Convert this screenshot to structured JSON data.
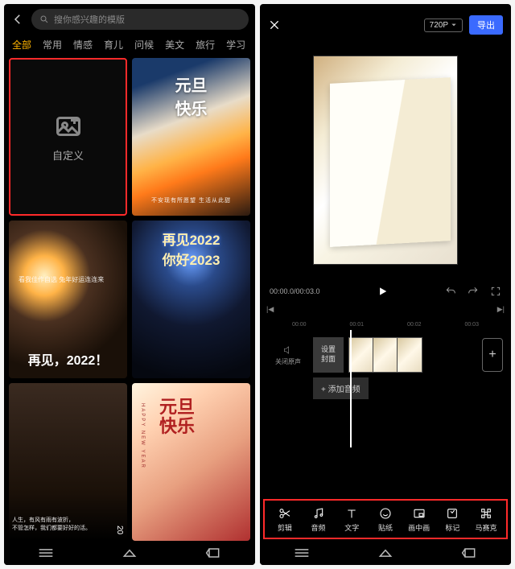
{
  "left": {
    "search_placeholder": "搜你感兴趣的模版",
    "tabs": [
      "全部",
      "常用",
      "情感",
      "育儿",
      "问候",
      "美文",
      "旅行",
      "学习"
    ],
    "custom_label": "自定义",
    "card_sunset": {
      "title": "元旦\n快乐",
      "sub": "不安现有所愿望  生活从此甜"
    },
    "card_fw1": {
      "small": "看我佳作自选  兔年好运连连来",
      "bottom": "再见，2022！"
    },
    "card_fw2": {
      "l1": "再见2022",
      "l2": "你好2023"
    },
    "card_crowd": {
      "txt": "人生，有风有雨有波折，\n不管怎样，我们都要好好的活。",
      "year": "20"
    },
    "card_red": {
      "happy": "HAPPY NEW YEAR",
      "big": "元旦\n快乐"
    }
  },
  "right": {
    "resolution": "720P",
    "export": "导出",
    "time": "00:00.0/00:03.0",
    "ruler": [
      "00:00",
      "00:01",
      "00:02",
      "00:03"
    ],
    "mute": "关闭原声",
    "cover": "设置\n封面",
    "add_audio": "+ 添加音频",
    "skip_prev": "|◀",
    "skip_next": "▶|",
    "tools": [
      {
        "name": "cut",
        "label": "剪辑"
      },
      {
        "name": "audio",
        "label": "音频"
      },
      {
        "name": "text",
        "label": "文字"
      },
      {
        "name": "sticker",
        "label": "贴纸"
      },
      {
        "name": "pip",
        "label": "画中画"
      },
      {
        "name": "mark",
        "label": "标记"
      },
      {
        "name": "mosaic",
        "label": "马赛克"
      }
    ]
  }
}
